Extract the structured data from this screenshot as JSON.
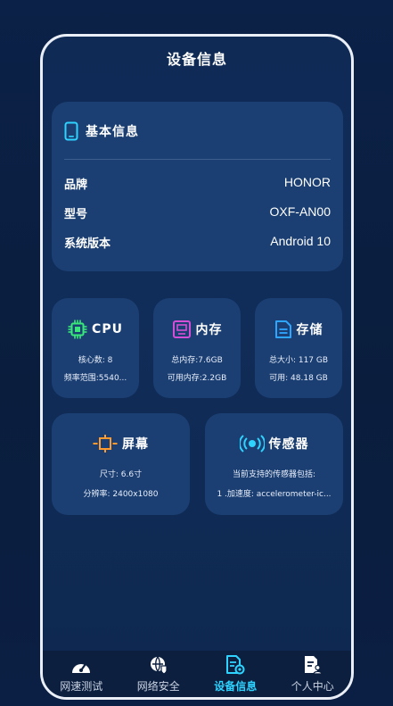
{
  "header": {
    "title": "设备信息"
  },
  "basic": {
    "title": "基本信息",
    "rows": [
      {
        "label": "品牌",
        "value": "HONOR"
      },
      {
        "label": "型号",
        "value": "OXF-AN00"
      },
      {
        "label": "系统版本",
        "value": "Android 10"
      }
    ]
  },
  "cpu": {
    "title": "CPU",
    "line1": "核心数:  8",
    "line2": "频率范围:5540..."
  },
  "memory": {
    "title": "内存",
    "line1": "总内存:7.6GB",
    "line2": "可用内存:2.2GB"
  },
  "storage": {
    "title": "存储",
    "line1": "总大小:  117 GB",
    "line2": "可用:  48.18 GB"
  },
  "screen": {
    "title": "屏幕",
    "line1": "尺寸: 6.6寸",
    "line2": "分辨率: 2400x1080"
  },
  "sensor": {
    "title": "传感器",
    "line1": "当前支持的传感器包括:",
    "line2": "1 .加速度: accelerometer-ic..."
  },
  "nav": {
    "items": [
      {
        "label": "网速测试",
        "icon": "speedometer-icon"
      },
      {
        "label": "网络安全",
        "icon": "shield-globe-icon"
      },
      {
        "label": "设备信息",
        "icon": "device-doc-icon"
      },
      {
        "label": "个人中心",
        "icon": "user-doc-icon"
      }
    ],
    "active_index": 2
  },
  "colors": {
    "accent": "#2ed3ff",
    "card": "#1b3f72",
    "cpu_icon": "#39e87a",
    "memory_icon": "#d54fd6",
    "storage_icon": "#2ea6ff",
    "screen_icon": "#ff9a2e",
    "sensor_icon": "#2ed3ff"
  }
}
